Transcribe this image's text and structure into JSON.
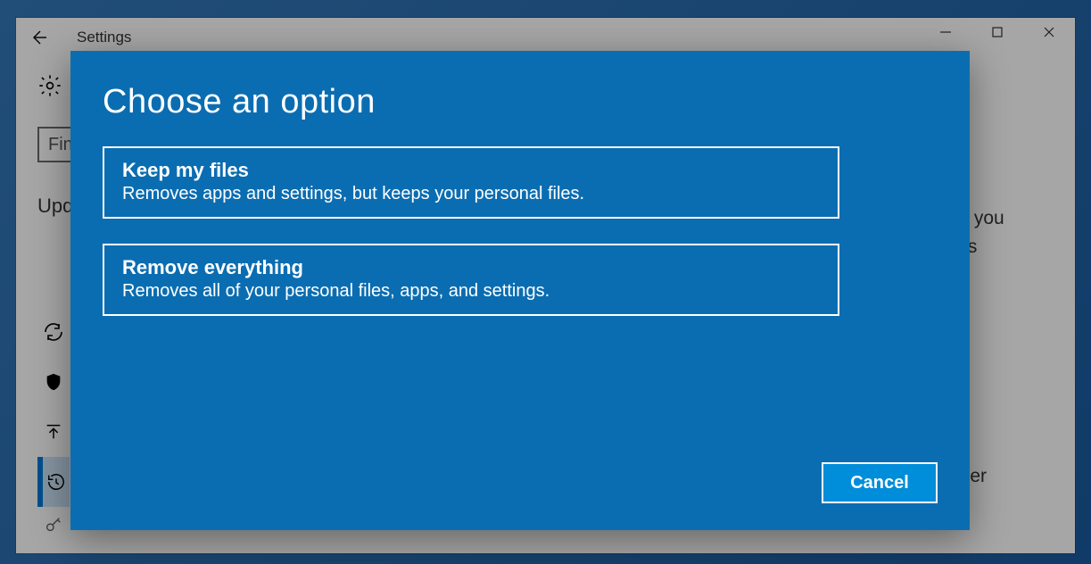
{
  "window": {
    "title": "Settings",
    "back_icon": "back-arrow-icon",
    "min_icon": "minimize-icon",
    "max_icon": "restore-icon",
    "close_icon": "close-icon"
  },
  "header_icon": "gear-icon",
  "search": {
    "placeholder": "Find a setting"
  },
  "category_label": "Update & security",
  "side": {
    "items": [
      {
        "icon": "sync-icon",
        "selected": false
      },
      {
        "icon": "shield-icon",
        "selected": false
      },
      {
        "icon": "upload-icon",
        "selected": false
      },
      {
        "icon": "history-icon",
        "selected": true
      },
      {
        "icon": "key-icon",
        "selected": false
      }
    ]
  },
  "body_fragments": {
    "right1a": "ets you",
    "right1b": "talls",
    "right2": "lier"
  },
  "dialog": {
    "title": "Choose an option",
    "options": [
      {
        "title": "Keep my files",
        "desc": "Removes apps and settings, but keeps your personal files."
      },
      {
        "title": "Remove everything",
        "desc": "Removes all of your personal files, apps, and settings."
      }
    ],
    "cancel_label": "Cancel"
  }
}
